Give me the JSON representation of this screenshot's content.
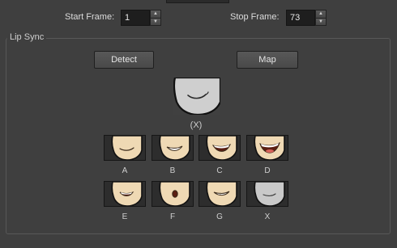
{
  "frames": {
    "start_label": "Start Frame:",
    "start_value": "1",
    "stop_label": "Stop Frame:",
    "stop_value": "73"
  },
  "lip_sync": {
    "title": "Lip Sync",
    "detect_label": "Detect",
    "map_label": "Map",
    "preview_caption": "(X)",
    "mouths": [
      {
        "label": "A",
        "shape": "closed-smile"
      },
      {
        "label": "B",
        "shape": "teeth-grin"
      },
      {
        "label": "C",
        "shape": "open-teeth"
      },
      {
        "label": "D",
        "shape": "wide-open"
      },
      {
        "label": "E",
        "shape": "small-open"
      },
      {
        "label": "F",
        "shape": "round-o"
      },
      {
        "label": "G",
        "shape": "teeth-bite"
      },
      {
        "label": "X",
        "shape": "neutral"
      }
    ]
  },
  "colors": {
    "background": "#3f3f3f",
    "skin": "#efd9b4",
    "neutral_skin": "#c9c9c9"
  }
}
